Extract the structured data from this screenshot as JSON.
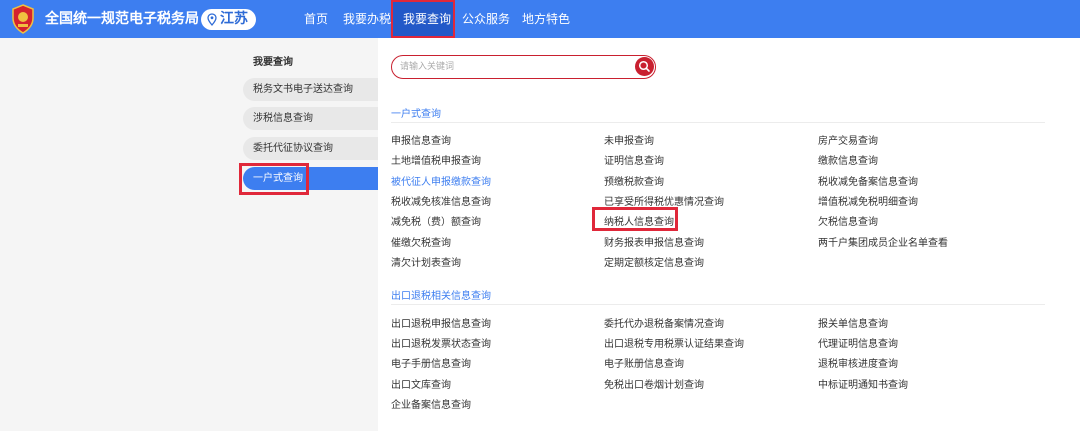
{
  "header": {
    "site_title": "全国统一规范电子税务局",
    "region": "江苏",
    "nav": [
      "首页",
      "我要办税",
      "我要查询",
      "公众服务",
      "地方特色"
    ],
    "active_nav": "我要查询",
    "brand_color": "#3d7ef0"
  },
  "sidebar": {
    "title": "我要查询",
    "items": [
      {
        "label": "税务文书电子送达查询"
      },
      {
        "label": "涉税信息查询"
      },
      {
        "label": "委托代征协议查询"
      },
      {
        "label": "一户式查询",
        "active": true
      }
    ]
  },
  "search": {
    "placeholder": "请输入关键词",
    "icon": "search-icon"
  },
  "sections": [
    {
      "title": "一户式查询",
      "columns": [
        [
          "申报信息查询",
          "土地增值税申报查询",
          "被代征人申报缴款查询",
          "税收减免核准信息查询",
          "减免税（费）额查询",
          "催缴欠税查询",
          "清欠计划表查询"
        ],
        [
          "未申报查询",
          "证明信息查询",
          "预缴税款查询",
          "已享受所得税优惠情况查询",
          "纳税人信息查询",
          "财务报表申报信息查询",
          "定期定额核定信息查询"
        ],
        [
          "房产交易查询",
          "缴款信息查询",
          "税收减免备案信息查询",
          "增值税减免税明细查询",
          "欠税信息查询",
          "两千户集团成员企业名单查看"
        ]
      ]
    },
    {
      "title": "出口退税相关信息查询",
      "columns": [
        [
          "出口退税申报信息查询",
          "出口退税发票状态查询",
          "电子手册信息查询",
          "出口文库查询",
          "企业备案信息查询"
        ],
        [
          "委托代办退税备案情况查询",
          "出口退税专用税票认证结果查询",
          "电子账册信息查询",
          "免税出口卷烟计划查询"
        ],
        [
          "报关单信息查询",
          "代理证明信息查询",
          "退税审核进度查询",
          "中标证明通知书查询"
        ]
      ]
    }
  ],
  "highlight_color": "#e0283a"
}
